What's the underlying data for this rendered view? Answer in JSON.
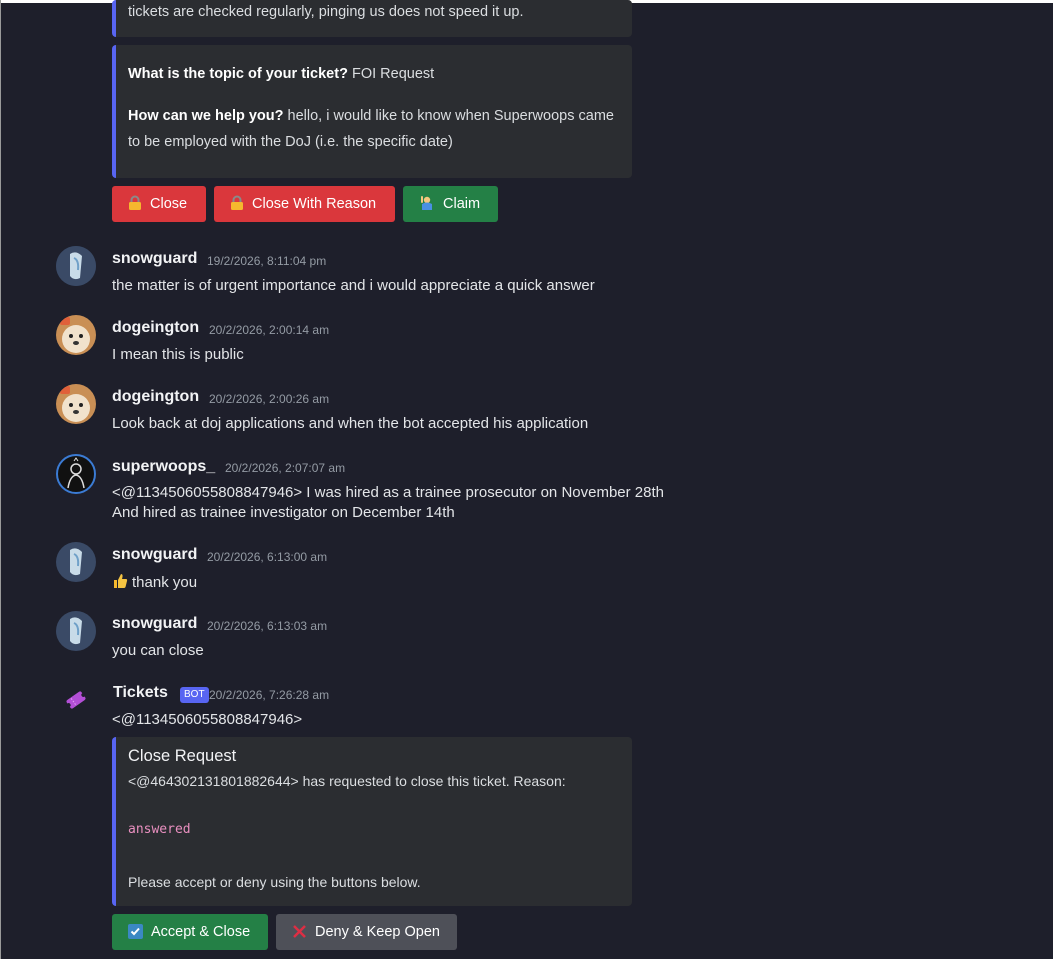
{
  "foi_embed": {
    "top_text": "tickets are checked regularly, pinging us does not speed it up.",
    "q1_label": "What is the topic of your ticket?",
    "q1_value": " FOI Request",
    "q2_label": "How can we help you?",
    "q2_value_line1": " hello, i would like to know when Superwoops came",
    "q2_value_line2": "to be employed with the DoJ (i.e. the specific date)"
  },
  "ticket_buttons": {
    "close": "Close",
    "close_with_reason": "Close With Reason",
    "claim": "Claim"
  },
  "messages": [
    {
      "author": "snowguard",
      "timestamp": "19/2/2026, 8:11:04 pm",
      "text": "the matter is of urgent importance and i would appreciate a quick answer"
    },
    {
      "author": "dogeington",
      "timestamp": "20/2/2026, 2:00:14 am",
      "text": "I mean this is public"
    },
    {
      "author": "dogeington",
      "timestamp": "20/2/2026, 2:00:26 am",
      "text": "Look back at doj applications and when the bot accepted his application"
    },
    {
      "author": "superwoops_",
      "timestamp": "20/2/2026, 2:07:07 am",
      "text": "<@1134506055808847946> I was hired as a trainee prosecutor on November 28th",
      "text2": "And hired as trainee investigator on December 14th"
    },
    {
      "author": "snowguard",
      "timestamp": "20/2/2026, 6:13:00 am",
      "text": "thank you"
    },
    {
      "author": "snowguard",
      "timestamp": "20/2/2026, 6:13:03 am",
      "text": "you can close"
    },
    {
      "author": "Tickets",
      "badge": "BOT",
      "timestamp": "20/2/2026, 7:26:28 am",
      "text": "<@1134506055808847946>"
    }
  ],
  "close_request": {
    "title": "Close Request",
    "description": "<@464302131801882644> has requested to close this ticket. Reason:",
    "reason": "answered",
    "footer": "Please accept or deny using the buttons below."
  },
  "close_buttons": {
    "accept": "Accept & Close",
    "deny": "Deny & Keep Open"
  },
  "colors": {
    "background": "#1e1f2b",
    "embed_accent": "#5865f2",
    "danger": "#da373c",
    "success": "#248046",
    "secondary": "#4e5058"
  }
}
